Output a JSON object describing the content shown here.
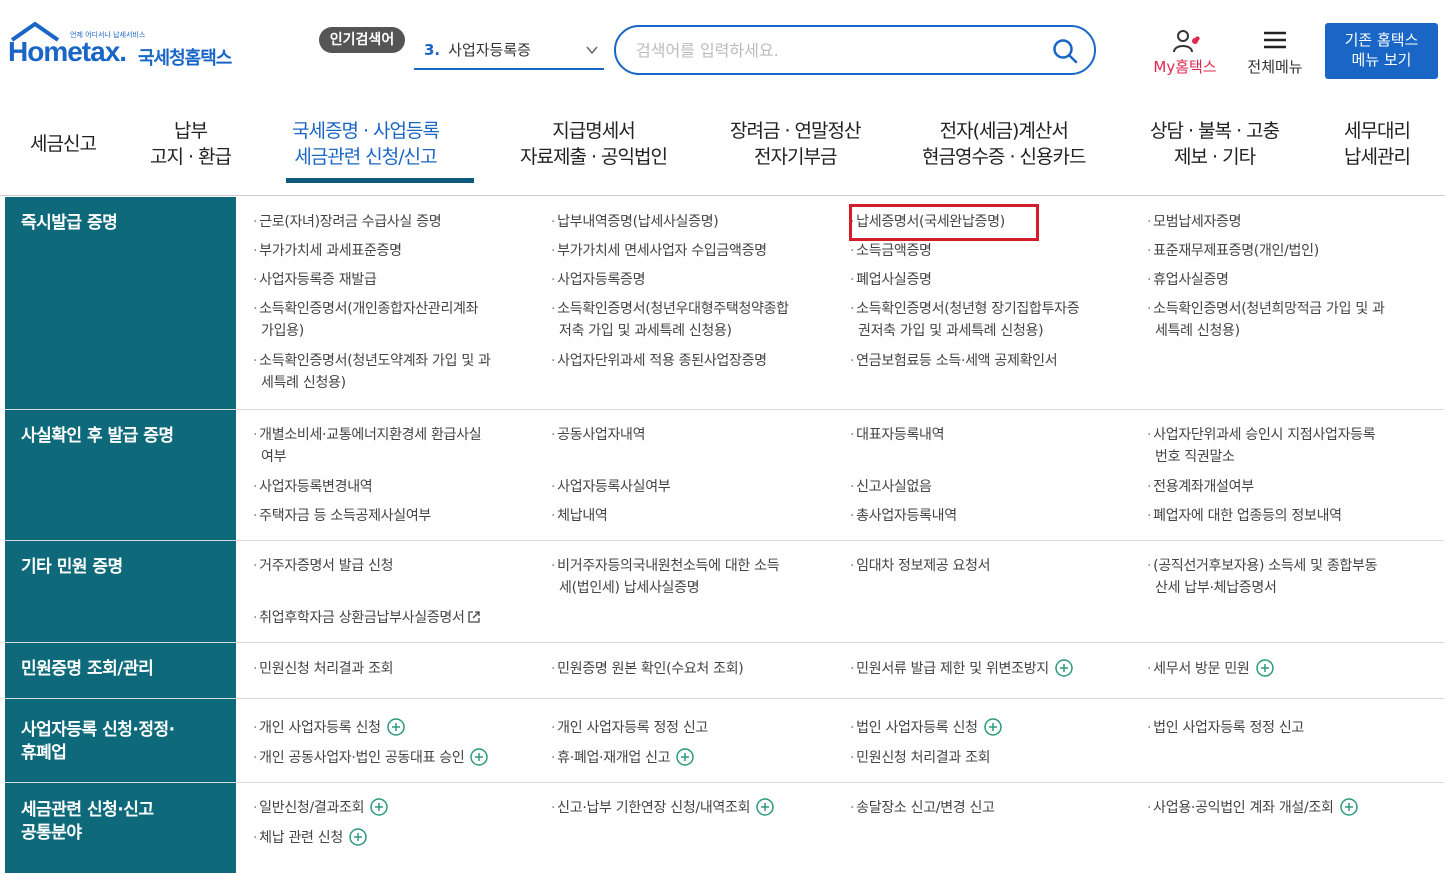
{
  "header": {
    "logo_small": "언제 어디서나 납세서비스",
    "logo_home": "Hometax.",
    "logo_kr": "국세청홈택스",
    "popular_badge": "인기검색어",
    "popular_num": "3.",
    "popular_term": "사업자등록증",
    "search_placeholder": "검색어를 입력하세요.",
    "my_label": "My홈택스",
    "all_menu_label": "전체메뉴",
    "old_btn_line1": "기존 홈택스",
    "old_btn_line2": "메뉴 보기"
  },
  "nav": {
    "items": [
      {
        "l1": "세금신고",
        "l2": ""
      },
      {
        "l1": "납부",
        "l2": "고지 · 환급"
      },
      {
        "l1": "국세증명 · 사업등록",
        "l2": "세금관련 신청/신고"
      },
      {
        "l1": "지급명세서",
        "l2": "자료제출 · 공익법인"
      },
      {
        "l1": "장려금 · 연말정산",
        "l2": "전자기부금"
      },
      {
        "l1": "전자(세금)계산서",
        "l2": "현금영수증 · 신용카드"
      },
      {
        "l1": "상담 · 불복 · 고충",
        "l2": "제보 · 기타"
      },
      {
        "l1": "세무대리",
        "l2": "납세관리"
      }
    ]
  },
  "rows": [
    {
      "category": [
        "즉시발급 증명"
      ],
      "cells": [
        {
          "lines": [
            "근로(자녀)장려금 수급사실 증명"
          ]
        },
        {
          "lines": [
            "납부내역증명(납세사실증명)"
          ]
        },
        {
          "lines": [
            "납세증명서(국세완납증명)"
          ]
        },
        {
          "lines": [
            "모범납세자증명"
          ]
        },
        {
          "lines": [
            "부가가치세 과세표준증명"
          ]
        },
        {
          "lines": [
            "부가가치세 면세사업자 수입금액증명"
          ]
        },
        {
          "lines": [
            "소득금액증명"
          ]
        },
        {
          "lines": [
            "표준재무제표증명(개인/법인)"
          ]
        },
        {
          "lines": [
            "사업자등록증 재발급"
          ]
        },
        {
          "lines": [
            "사업자등록증명"
          ]
        },
        {
          "lines": [
            "폐업사실증명"
          ]
        },
        {
          "lines": [
            "휴업사실증명"
          ]
        },
        {
          "lines": [
            "소득확인증명서(개인종합자산관리계좌",
            "가입용)"
          ]
        },
        {
          "lines": [
            "소득확인증명서(청년우대형주택청약종합",
            "저축 가입 및 과세특례 신청용)"
          ]
        },
        {
          "lines": [
            "소득확인증명서(청년형 장기집합투자증",
            "권저축 가입 및 과세특례 신청용)"
          ]
        },
        {
          "lines": [
            "소득확인증명서(청년희망적금 가입 및 과",
            "세특례 신청용)"
          ]
        },
        {
          "lines": [
            "소득확인증명서(청년도약계좌 가입 및 과",
            "세특례 신청용)"
          ]
        },
        {
          "lines": [
            "사업자단위과세 적용 종된사업장증명"
          ]
        },
        {
          "lines": [
            "연금보험료등 소득·세액 공제확인서"
          ]
        }
      ]
    },
    {
      "category": [
        "사실확인 후 발급 증명"
      ],
      "cells": [
        {
          "lines": [
            "개별소비세·교통에너지환경세 환급사실",
            "여부"
          ]
        },
        {
          "lines": [
            "공동사업자내역"
          ]
        },
        {
          "lines": [
            "대표자등록내역"
          ]
        },
        {
          "lines": [
            "사업자단위과세 승인시 지점사업자등록",
            "번호 직권말소"
          ]
        },
        {
          "lines": [
            "사업자등록변경내역"
          ]
        },
        {
          "lines": [
            "사업자등록사실여부"
          ]
        },
        {
          "lines": [
            "신고사실없음"
          ]
        },
        {
          "lines": [
            "전용계좌개설여부"
          ]
        },
        {
          "lines": [
            "주택자금 등 소득공제사실여부"
          ]
        },
        {
          "lines": [
            "체납내역"
          ]
        },
        {
          "lines": [
            "총사업자등록내역"
          ]
        },
        {
          "lines": [
            "폐업자에 대한 업종등의 정보내역"
          ]
        }
      ]
    },
    {
      "category": [
        "기타 민원 증명"
      ],
      "cells": [
        {
          "lines": [
            "거주자증명서 발급 신청"
          ]
        },
        {
          "lines": [
            "비거주자등의국내원천소득에 대한 소득",
            "세(법인세) 납세사실증명"
          ]
        },
        {
          "lines": [
            "임대차 정보제공 요청서"
          ]
        },
        {
          "lines": [
            "(공직선거후보자용) 소득세 및 종합부동",
            "산세 납부·체납증명서"
          ]
        },
        {
          "lines": [
            "취업후학자금 상환금납부사실증명서"
          ]
        }
      ]
    },
    {
      "category": [
        "민원증명 조회/관리"
      ],
      "cells": [
        {
          "lines": [
            "민원신청 처리결과 조회"
          ]
        },
        {
          "lines": [
            "민원증명 원본 확인(수요처 조회)"
          ]
        },
        {
          "lines": [
            "민원서류 발급 제한 및 위변조방지"
          ]
        },
        {
          "lines": [
            "세무서 방문 민원"
          ]
        }
      ]
    },
    {
      "category": [
        "사업자등록 신청·정정·",
        "휴폐업"
      ],
      "cells": [
        {
          "lines": [
            "개인 사업자등록 신청"
          ]
        },
        {
          "lines": [
            "개인 사업자등록 정정 신고"
          ]
        },
        {
          "lines": [
            "법인 사업자등록 신청"
          ]
        },
        {
          "lines": [
            "법인 사업자등록 정정 신고"
          ]
        },
        {
          "lines": [
            "개인 공동사업자·법인 공동대표 승인"
          ]
        },
        {
          "lines": [
            "휴·폐업·재개업 신고"
          ]
        },
        {
          "lines": [
            "민원신청 처리결과 조회"
          ]
        }
      ]
    },
    {
      "category": [
        "세금관련 신청·신고",
        "공통분야"
      ],
      "cells": [
        {
          "lines": [
            "일반신청/결과조회"
          ]
        },
        {
          "lines": [
            "신고·납부 기한연장 신청/내역조회"
          ]
        },
        {
          "lines": [
            "송달장소 신고/변경 신고"
          ]
        },
        {
          "lines": [
            "사업용·공익법인 계좌 개설/조회"
          ]
        },
        {
          "lines": [
            "체납 관련 신청"
          ]
        }
      ]
    }
  ],
  "colors": {
    "brand": "#1a66c6",
    "category_bg": "#0e6a7a",
    "highlight": "#d21e2b",
    "my_red": "#e0294d"
  }
}
